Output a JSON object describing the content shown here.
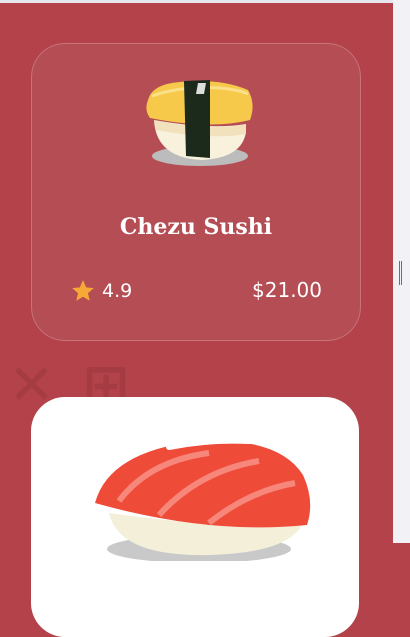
{
  "products": [
    {
      "title": "Chezu Sushi",
      "rating": "4.9",
      "price": "$21.00",
      "image_icon": "tamago-nigiri-icon",
      "rating_icon": "star-icon"
    },
    {
      "image_icon": "salmon-nigiri-icon"
    }
  ],
  "colors": {
    "page_background": "#b3424a",
    "card_background": "#b54d55",
    "star": "#f7a937",
    "text": "#ffffff"
  }
}
